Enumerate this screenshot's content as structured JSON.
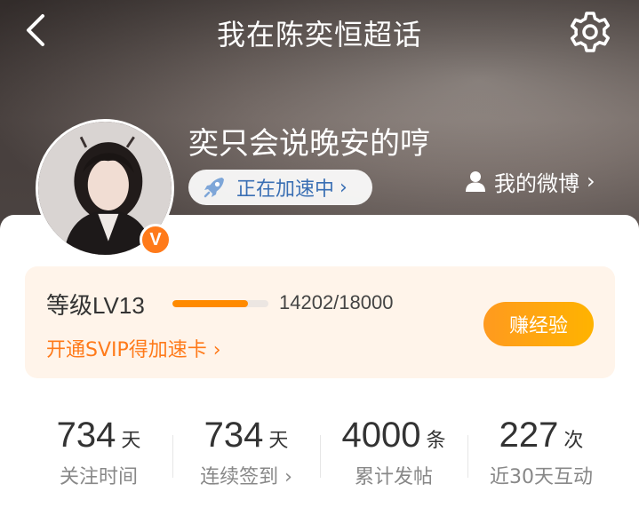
{
  "header": {
    "title": "我在陈奕恒超话"
  },
  "profile": {
    "name": "奕只会说晚安的哼",
    "boost_label": "正在加速中",
    "boost_chevron": "›",
    "weibo_label": "我的微博",
    "weibo_chevron": "›",
    "badge": "V"
  },
  "level": {
    "label_prefix": "等级",
    "level": "LV13",
    "xp_current": 14202,
    "xp_max": 18000,
    "xp_text": "14202/18000",
    "svip_link": "开通SVIP得加速卡 ›",
    "earn_button": "赚经验"
  },
  "stats": [
    {
      "value": "734",
      "unit": "天",
      "label": "关注时间"
    },
    {
      "value": "734",
      "unit": "天",
      "label": "连续签到 ›"
    },
    {
      "value": "4000",
      "unit": "条",
      "label": "累计发帖"
    },
    {
      "value": "227",
      "unit": "次",
      "label": "近30天互动"
    }
  ],
  "colors": {
    "accent": "#ff8a00",
    "boost_text": "#3a6fb4",
    "level_bg": "#fff4ea"
  }
}
